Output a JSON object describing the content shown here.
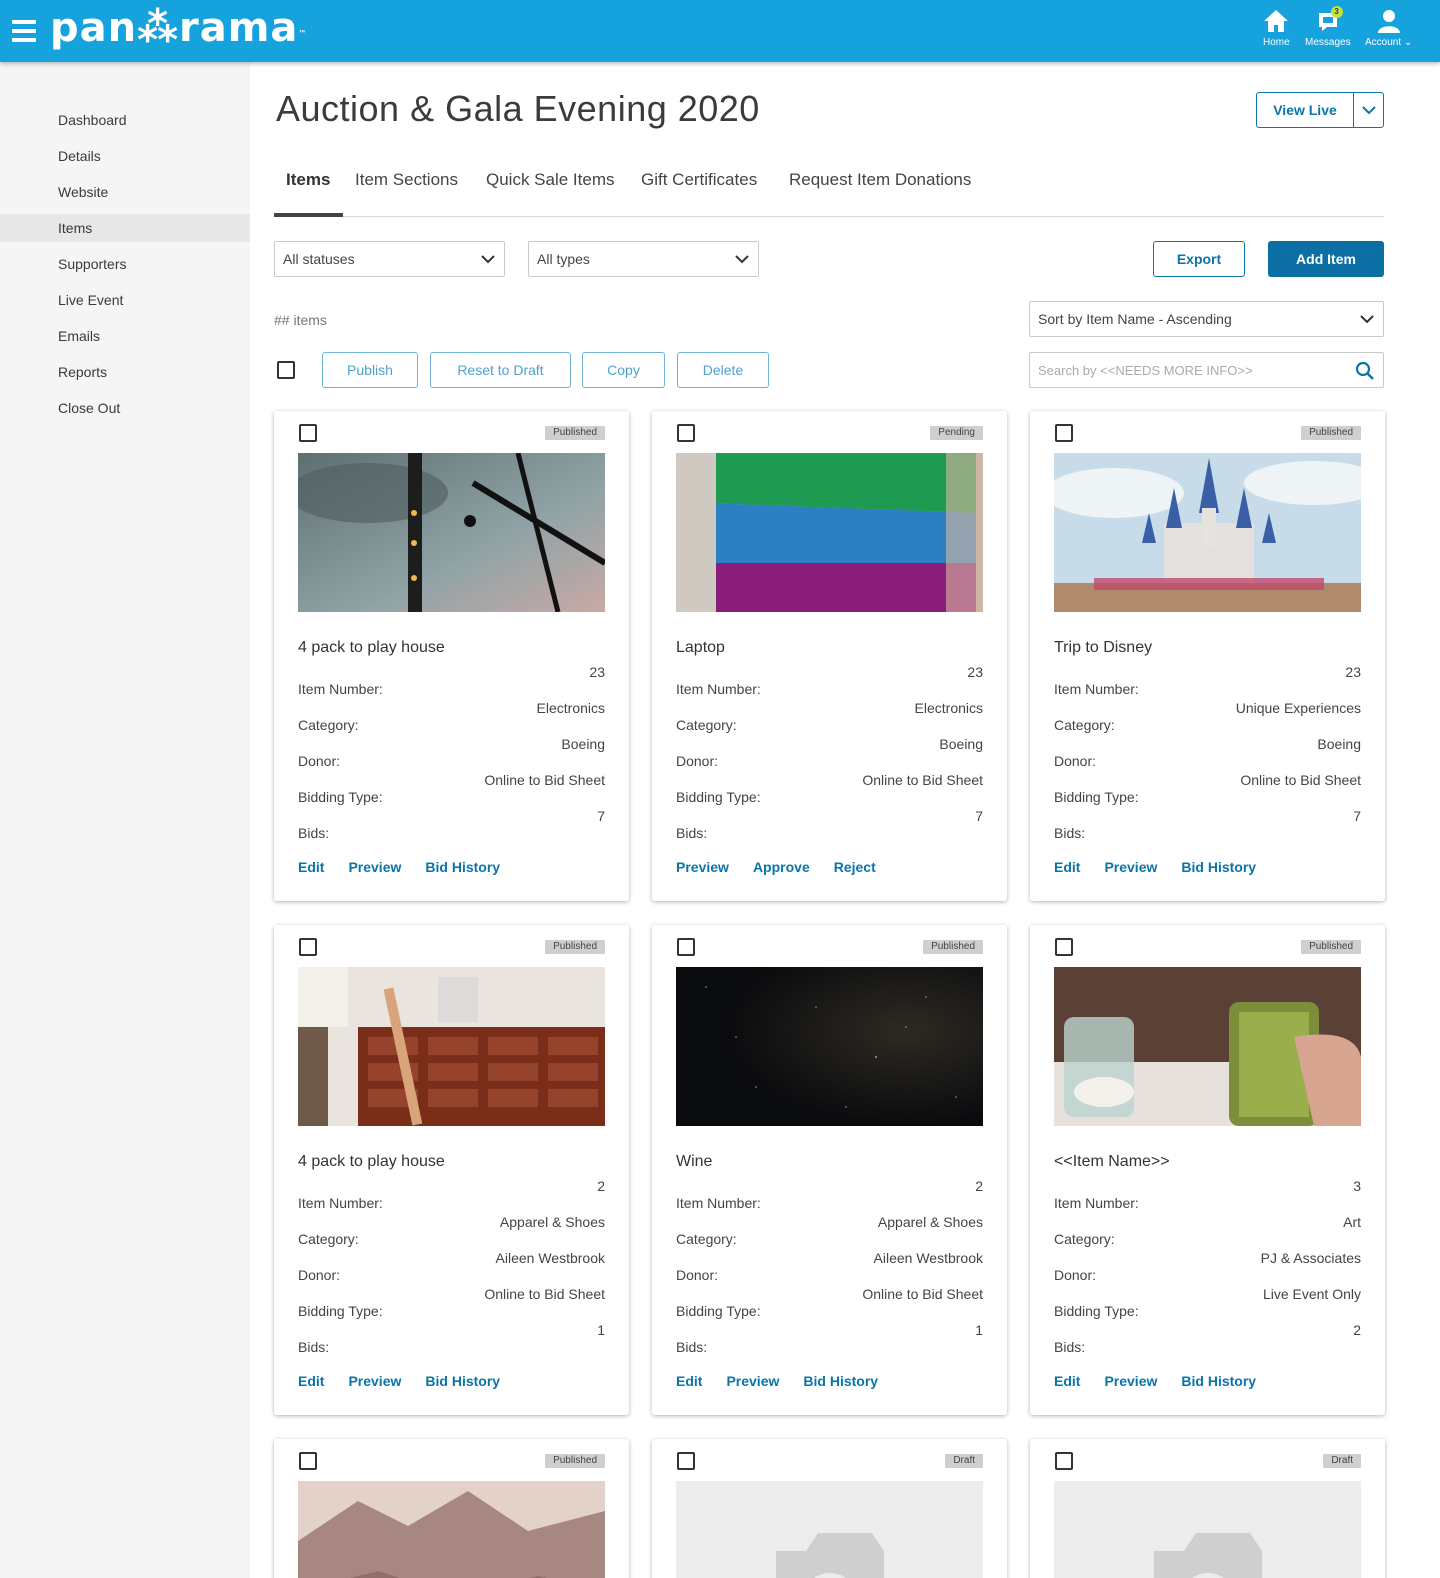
{
  "app": {
    "logo": "pan⁂rama",
    "trademark": "™"
  },
  "topnav": {
    "home_label": "Home",
    "messages_label": "Messages",
    "messages_badge": "3",
    "account_label": "Account"
  },
  "sidebar": {
    "items": [
      {
        "label": "Dashboard"
      },
      {
        "label": "Details"
      },
      {
        "label": "Website"
      },
      {
        "label": "Items"
      },
      {
        "label": "Supporters"
      },
      {
        "label": "Live Event"
      },
      {
        "label": "Emails"
      },
      {
        "label": "Reports"
      },
      {
        "label": "Close Out"
      }
    ],
    "active": "Items"
  },
  "page": {
    "title": "Auction & Gala Evening 2020",
    "view_live_label": "View Live"
  },
  "tabs": [
    {
      "label": "Items"
    },
    {
      "label": "Item Sections"
    },
    {
      "label": "Quick Sale Items"
    },
    {
      "label": "Gift Certificates"
    },
    {
      "label": "Request Item Donations"
    }
  ],
  "filters": {
    "status_selected": "All statuses",
    "type_selected": "All types",
    "sort_selected": "Sort by Item Name - Ascending",
    "search_placeholder": "Search by <<NEEDS MORE INFO>>"
  },
  "toolbar": {
    "export_label": "Export",
    "add_item_label": "Add Item",
    "item_count": "## items",
    "publish_label": "Publish",
    "reset_label": "Reset to Draft",
    "copy_label": "Copy",
    "delete_label": "Delete"
  },
  "field_labels": {
    "item_number": "Item Number:",
    "category": "Category:",
    "donor": "Donor:",
    "bidding_type": "Bidding Type:",
    "bids": "Bids:"
  },
  "cards": [
    {
      "status": "Published",
      "title": "4 pack to play house",
      "item_number": "23",
      "category": "Electronics",
      "donor": "Boeing",
      "bidding_type": "Online to Bid Sheet",
      "bids": "7",
      "actions": [
        "Edit",
        "Preview",
        "Bid History"
      ]
    },
    {
      "status": "Pending",
      "title": "Laptop",
      "item_number": "23",
      "category": "Electronics",
      "donor": "Boeing",
      "bidding_type": "Online to Bid Sheet",
      "bids": "7",
      "actions": [
        "Preview",
        "Approve",
        "Reject"
      ]
    },
    {
      "status": "Published",
      "title": "Trip to Disney",
      "item_number": "23",
      "category": "Unique Experiences",
      "donor": "Boeing",
      "bidding_type": "Online to Bid Sheet",
      "bids": "7",
      "actions": [
        "Edit",
        "Preview",
        "Bid History"
      ]
    },
    {
      "status": "Published",
      "title": "4 pack to play house",
      "item_number": "2",
      "category": "Apparel & Shoes",
      "donor": "Aileen Westbrook",
      "bidding_type": "Online to Bid Sheet",
      "bids": "1",
      "actions": [
        "Edit",
        "Preview",
        "Bid History"
      ]
    },
    {
      "status": "Published",
      "title": "Wine",
      "item_number": "2",
      "category": "Apparel & Shoes",
      "donor": "Aileen Westbrook",
      "bidding_type": "Online to Bid Sheet",
      "bids": "1",
      "actions": [
        "Edit",
        "Preview",
        "Bid History"
      ]
    },
    {
      "status": "Published",
      "title": "<<Item Name>>",
      "item_number": "3",
      "category": "Art",
      "donor": "PJ & Associates",
      "bidding_type": "Live Event Only",
      "bids": "2",
      "actions": [
        "Edit",
        "Preview",
        "Bid History"
      ]
    },
    {
      "status": "Published"
    },
    {
      "status": "Draft"
    },
    {
      "status": "Draft"
    }
  ],
  "colors": {
    "topbar": "#16a2dc",
    "primary": "#0b75a8",
    "sidebar_bg": "#f5f5f5"
  }
}
